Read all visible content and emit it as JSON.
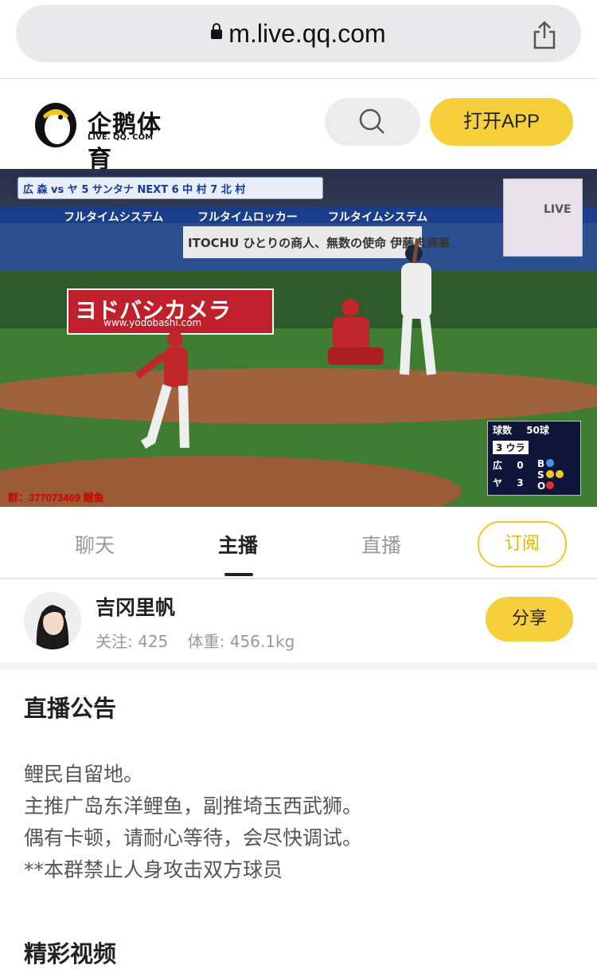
{
  "browser": {
    "url": "m.live.qq.com",
    "icons": {
      "lock": "lock-icon",
      "share": "share-icon"
    }
  },
  "header": {
    "logo_text": "企鹅体育",
    "logo_sub": "LIVE. QQ. COM",
    "search_icon": "search-icon",
    "open_app": "打开APP",
    "accent_color": "#f5d03c"
  },
  "video": {
    "score_top": "広  森  vs  ヤ  5 サンタナ  NEXT  6 中 村  7 北 村",
    "ad_banners": [
      "フルタイムシステム",
      "フルタイムロッカー",
      "フルタイムシステム"
    ],
    "ad_yodobashi": "ヨドバシカメラ",
    "ad_yodobashi_url": "www.yodobashi.com",
    "ad_itochu": "ITOCHU  ひとりの商人、無数の使命  伊藤忠商事",
    "live_logo": "LIVE",
    "pitch_count_label": "球数",
    "pitch_count": "50球",
    "inning": "3 ウラ",
    "team1": "広",
    "team1_score": "0",
    "team2": "ヤ",
    "team2_score": "3",
    "count_labels": [
      "B",
      "S",
      "O"
    ],
    "group_watermark": "群：377073469 鲤鱼"
  },
  "tabs": {
    "items": [
      "聊天",
      "主播",
      "直播"
    ],
    "active_index": 1,
    "subscribe": "订阅"
  },
  "anchor": {
    "name": "吉冈里帆",
    "follow_label": "关注: 425",
    "weight_label": "体重: 456.1kg",
    "share": "分享"
  },
  "notice": {
    "title": "直播公告",
    "lines": [
      "鲤民自留地。",
      "主推广岛东洋鲤鱼，副推埼玉西武狮。",
      "偶有卡顿，请耐心等待，会尽快调试。",
      "**本群禁止人身攻击双方球员"
    ]
  },
  "next_section": "精彩视频"
}
